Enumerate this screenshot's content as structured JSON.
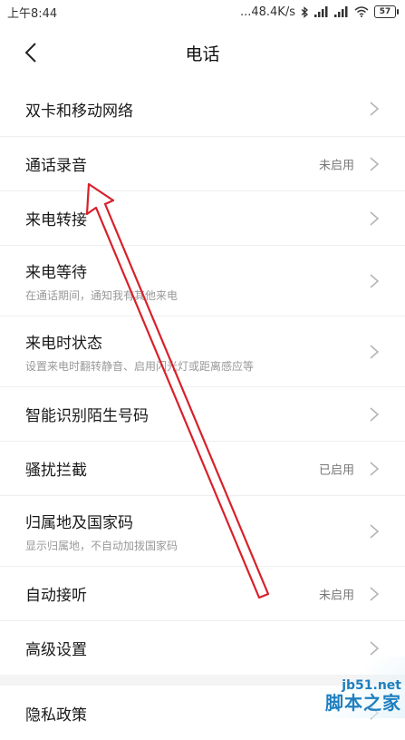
{
  "statusbar": {
    "time": "上午8:44",
    "network_speed": "...48.4K/s",
    "battery": "57"
  },
  "header": {
    "title": "电话"
  },
  "settings": [
    {
      "label": "双卡和移动网络",
      "sub": "",
      "value": ""
    },
    {
      "label": "通话录音",
      "sub": "",
      "value": "未启用"
    },
    {
      "label": "来电转接",
      "sub": "",
      "value": ""
    },
    {
      "label": "来电等待",
      "sub": "在通话期间，通知我有其他来电",
      "value": ""
    },
    {
      "label": "来电时状态",
      "sub": "设置来电时翻转静音、启用闪光灯或距离感应等",
      "value": ""
    },
    {
      "label": "智能识别陌生号码",
      "sub": "",
      "value": ""
    },
    {
      "label": "骚扰拦截",
      "sub": "",
      "value": "已启用"
    },
    {
      "label": "归属地及国家码",
      "sub": "显示归属地，不自动加拨国家码",
      "value": ""
    },
    {
      "label": "自动接听",
      "sub": "",
      "value": "未启用"
    },
    {
      "label": "高级设置",
      "sub": "",
      "value": ""
    }
  ],
  "privacy": {
    "label": "隐私政策"
  },
  "watermark": {
    "url": "jb51.net",
    "name": "脚本之家"
  },
  "colors": {
    "annotation_arrow": "#d8202a",
    "watermark": "#1e7fbf"
  }
}
